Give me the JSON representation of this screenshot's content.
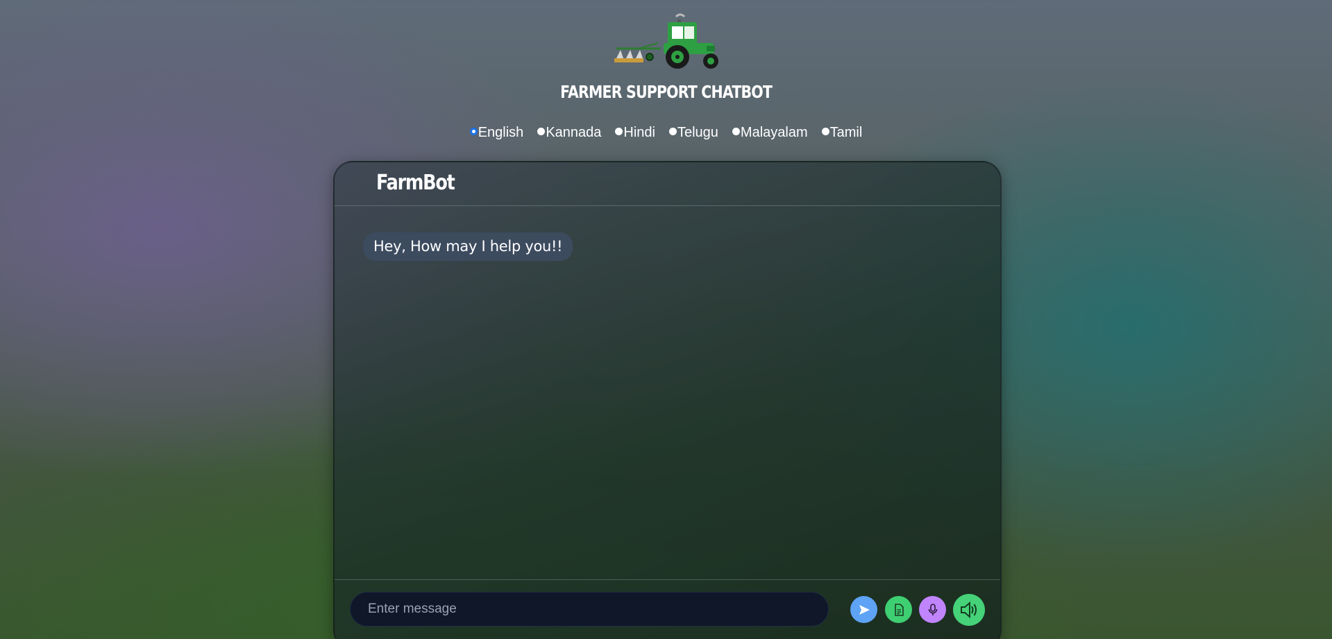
{
  "header": {
    "title": "FARMER SUPPORT CHATBOT",
    "logo_icon": "tractor-with-plough-icon"
  },
  "languages": {
    "selected": "English",
    "options": [
      "English",
      "Kannada",
      "Hindi",
      "Telugu",
      "Malayalam",
      "Tamil"
    ]
  },
  "chat": {
    "bot_name": "FarmBot",
    "messages": [
      {
        "sender": "bot",
        "text": "Hey, How may I help you!!"
      }
    ]
  },
  "composer": {
    "input_value": "",
    "input_placeholder": "Enter message",
    "buttons": [
      {
        "name": "send-button",
        "icon": "send-icon",
        "color": "#5ea3f5"
      },
      {
        "name": "document-button",
        "icon": "document-icon",
        "color": "#3ecf72"
      },
      {
        "name": "microphone-button",
        "icon": "microphone-icon",
        "color": "#c084fc"
      },
      {
        "name": "speaker-button",
        "icon": "speaker-icon",
        "color": "#45d278"
      }
    ]
  }
}
